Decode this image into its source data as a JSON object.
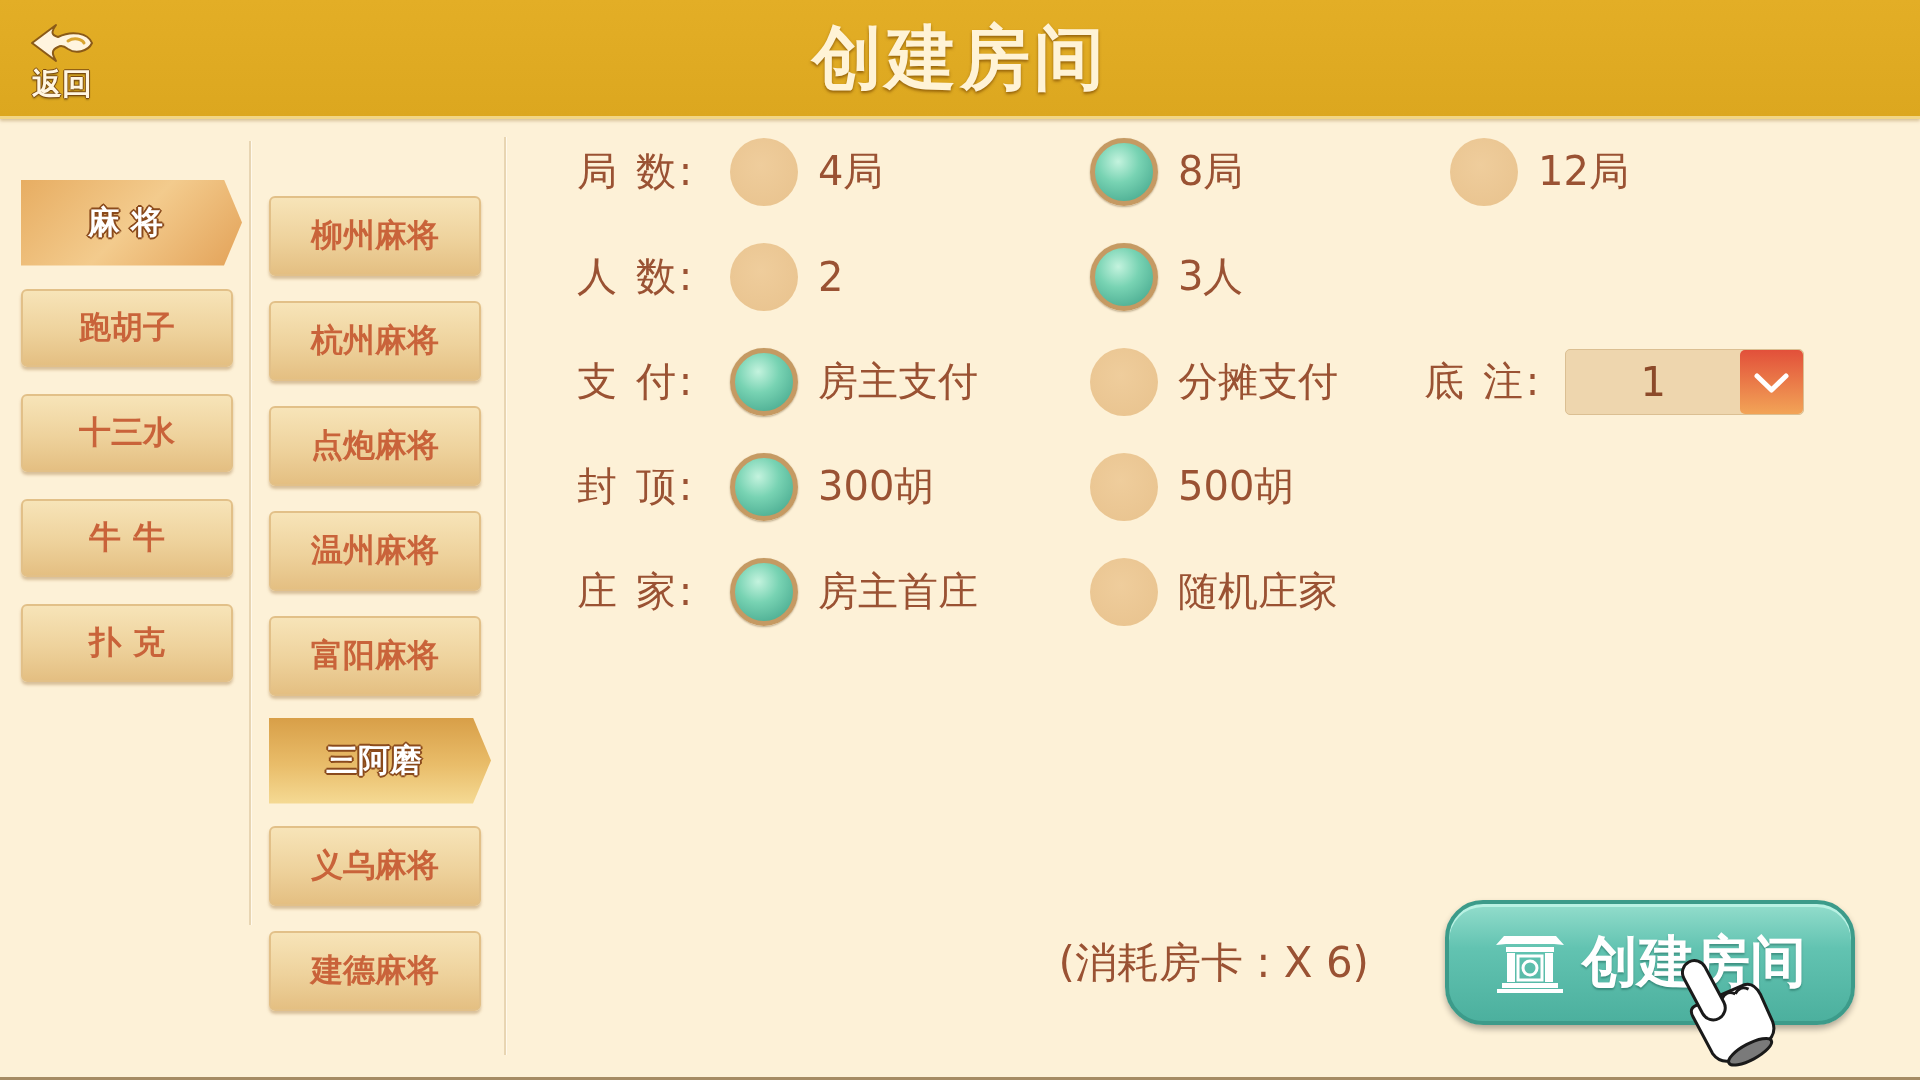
{
  "header": {
    "back_label": "返回",
    "title": "创建房间"
  },
  "categories": [
    {
      "label": "麻 将",
      "selected": true
    },
    {
      "label": "跑胡子",
      "selected": false
    },
    {
      "label": "十三水",
      "selected": false
    },
    {
      "label": "牛 牛",
      "selected": false
    },
    {
      "label": "扑 克",
      "selected": false
    }
  ],
  "games": [
    {
      "label": "柳州麻将",
      "selected": false
    },
    {
      "label": "杭州麻将",
      "selected": false
    },
    {
      "label": "点炮麻将",
      "selected": false
    },
    {
      "label": "温州麻将",
      "selected": false
    },
    {
      "label": "富阳麻将",
      "selected": false
    },
    {
      "label": "三阿磨",
      "selected": true
    },
    {
      "label": "义乌麻将",
      "selected": false
    },
    {
      "label": "建德麻将",
      "selected": false
    }
  ],
  "options": [
    {
      "label": "局 数:",
      "choices": [
        {
          "label": "4局",
          "selected": false
        },
        {
          "label": "8局",
          "selected": true
        },
        {
          "label": "12局",
          "selected": false
        }
      ]
    },
    {
      "label": "人 数:",
      "choices": [
        {
          "label": "2",
          "selected": false
        },
        {
          "label": "3人",
          "selected": true
        }
      ]
    },
    {
      "label": "支 付:",
      "choices": [
        {
          "label": "房主支付",
          "selected": true
        },
        {
          "label": "分摊支付",
          "selected": false
        }
      ],
      "dropdown": {
        "label": "底 注:",
        "value": "1"
      }
    },
    {
      "label": "封 顶:",
      "choices": [
        {
          "label": "300胡",
          "selected": true
        },
        {
          "label": "500胡",
          "selected": false
        }
      ]
    },
    {
      "label": "庄 家:",
      "choices": [
        {
          "label": "房主首庄",
          "selected": true
        },
        {
          "label": "随机庄家",
          "selected": false
        }
      ]
    }
  ],
  "cost_note": "(消耗房卡 : X 6)",
  "create_button": {
    "label": "创建房间"
  }
}
